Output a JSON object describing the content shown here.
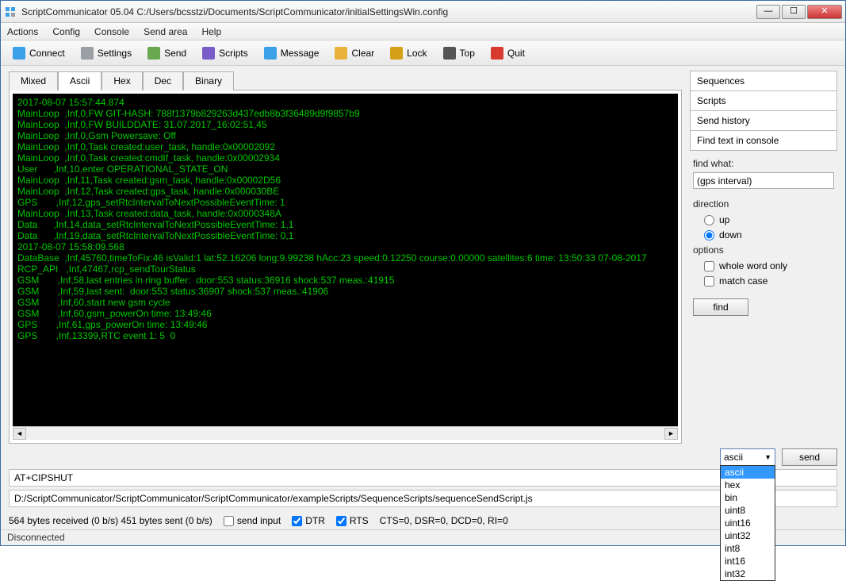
{
  "window": {
    "title": "ScriptCommunicator 05.04   C:/Users/bcsstzi/Documents/ScriptCommunicator/initialSettingsWin.config"
  },
  "menu": {
    "items": [
      "Actions",
      "Config",
      "Console",
      "Send area",
      "Help"
    ]
  },
  "toolbar": {
    "items": [
      {
        "label": "Connect",
        "icon": "#3aa0e8"
      },
      {
        "label": "Settings",
        "icon": "#9aa0a6"
      },
      {
        "label": "Send",
        "icon": "#6aa84f"
      },
      {
        "label": "Scripts",
        "icon": "#7a5cc9"
      },
      {
        "label": "Message",
        "icon": "#3aa0e8"
      },
      {
        "label": "Clear",
        "icon": "#e8b23a"
      },
      {
        "label": "Lock",
        "icon": "#d4a017"
      },
      {
        "label": "Top",
        "icon": "#555"
      },
      {
        "label": "Quit",
        "icon": "#d83a2f"
      }
    ]
  },
  "tabs": {
    "items": [
      "Mixed",
      "Ascii",
      "Hex",
      "Dec",
      "Binary"
    ],
    "active": 1
  },
  "console_lines": [
    "2017-08-07 15:57:44.874",
    "MainLoop  ,Inf,0,FW GIT-HASH: 788f1379b829263d437edb8b3f36489d9f9857b9",
    "MainLoop  ,Inf,0,FW BUILDDATE: 31.07.2017_16:02:51,45",
    "MainLoop  ,Inf,0,Gsm Powersave: Off",
    "MainLoop  ,Inf,0,Task created:user_task, handle:0x00002092",
    "MainLoop  ,Inf,0,Task created:cmdIf_task, handle:0x00002934",
    "User      ,Inf,10,enter OPERATIONAL_STATE_ON",
    "MainLoop  ,Inf,11,Task created:gsm_task, handle:0x00002D56",
    "MainLoop  ,Inf,12,Task created:gps_task, handle:0x000030BE",
    "GPS       ,Inf,12,gps_setRtcIntervalToNextPossibleEventTime: 1",
    "MainLoop  ,Inf,13,Task created:data_task, handle:0x0000348A",
    "Data      ,Inf,14,data_setRtcIntervalToNextPossibleEventTime: 1,1",
    "Data      ,Inf,19,data_setRtcIntervalToNextPossibleEventTime: 0,1",
    "2017-08-07 15:58:09.568",
    "DataBase  ,Inf,45760,timeToFix:46 isValid:1 lat:52.16206 long:9.99238 hAcc:23 speed:0.12250 course:0.00000 satellites:6 time: 13:50:33 07-08-2017",
    "RCP_API   ,Inf,47467,rcp_sendTourStatus",
    "GSM       ,Inf,58,last entries in ring buffer:  door:553 status:36916 shock:537 meas.:41915",
    "GSM       ,Inf,59,last sent:  door:553 status:36907 shock:537 meas.:41906",
    "GSM       ,Inf,60,start new gsm cycle",
    "GSM       ,Inf,60,gsm_powerOn time: 13:49:46",
    "GPS       ,Inf,61,gps_powerOn time: 13:49:46",
    "GPS       ,Inf,13399,RTC event 1: 5  0"
  ],
  "right_tabs": [
    "Sequences",
    "Scripts",
    "Send history",
    "Find text in console"
  ],
  "find": {
    "label": "find what:",
    "value": "(gps interval)",
    "direction_label": "direction",
    "up": "up",
    "down": "down",
    "options_label": "options",
    "whole_word": "whole word only",
    "match_case": "match case",
    "button": "find"
  },
  "send": {
    "combo_selected": "ascii",
    "combo_options": [
      "ascii",
      "hex",
      "bin",
      "uint8",
      "uint16",
      "uint32",
      "int8",
      "int16",
      "int32"
    ],
    "button": "send",
    "input_value": "AT+CIPSHUT",
    "script_path": "D:/ScriptCommunicator/ScriptCommunicator/ScriptCommunicator/exampleScripts/SequenceScripts/sequenceSendScript.js"
  },
  "status": {
    "bytes_text": "564 bytes received (0 b/s)   451 bytes sent (0 b/s)",
    "send_input": "send input",
    "dtr": "DTR",
    "rts": "RTS",
    "line_states": "CTS=0, DSR=0, DCD=0, RI=0",
    "bar": "Disconnected"
  }
}
